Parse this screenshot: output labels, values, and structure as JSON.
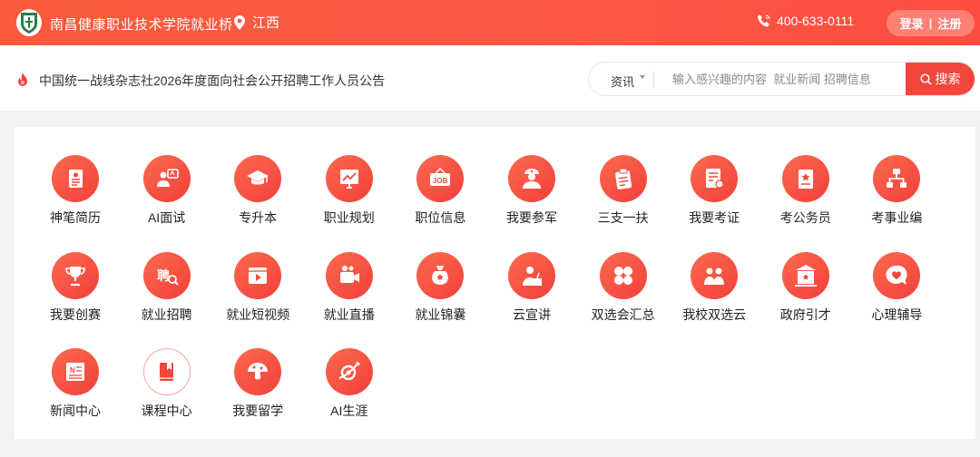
{
  "header": {
    "school_name": "南昌健康职业技术学院就业桥",
    "location": "江西",
    "phone": "400-633-0111",
    "login": "登录",
    "separator": "|",
    "register": "注册"
  },
  "newsbar": {
    "headline": "中国统一战线杂志社2026年度面向社会公开招聘工作人员公告",
    "search": {
      "category": "资讯",
      "placeholder": "输入感兴趣的内容  就业新闻 招聘信息",
      "button": "搜索"
    }
  },
  "services": [
    {
      "label": "神笔简历",
      "icon": "resume-icon"
    },
    {
      "label": "AI面试",
      "icon": "ai-interview-icon"
    },
    {
      "label": "专升本",
      "icon": "graduation-cap-icon"
    },
    {
      "label": "职业规划",
      "icon": "career-chart-icon"
    },
    {
      "label": "职位信息",
      "icon": "job-sign-icon"
    },
    {
      "label": "我要参军",
      "icon": "soldier-icon"
    },
    {
      "label": "三支一扶",
      "icon": "clipboard-icon"
    },
    {
      "label": "我要考证",
      "icon": "certificate-icon"
    },
    {
      "label": "考公务员",
      "icon": "star-document-icon"
    },
    {
      "label": "考事业编",
      "icon": "org-chart-icon"
    },
    {
      "label": "我要创赛",
      "icon": "trophy-icon"
    },
    {
      "label": "就业招聘",
      "icon": "recruit-search-icon"
    },
    {
      "label": "就业短视频",
      "icon": "video-play-icon"
    },
    {
      "label": "就业直播",
      "icon": "live-camera-icon"
    },
    {
      "label": "就业锦囊",
      "icon": "money-bag-icon"
    },
    {
      "label": "云宣讲",
      "icon": "speaker-podium-icon"
    },
    {
      "label": "双选会汇总",
      "icon": "grid-clover-icon"
    },
    {
      "label": "我校双选云",
      "icon": "two-people-icon"
    },
    {
      "label": "政府引才",
      "icon": "government-building-icon"
    },
    {
      "label": "心理辅导",
      "icon": "heart-chat-icon"
    },
    {
      "label": "新闻中心",
      "icon": "newspaper-icon"
    },
    {
      "label": "课程中心",
      "icon": "book-icon"
    },
    {
      "label": "我要留学",
      "icon": "mushroom-globe-icon"
    },
    {
      "label": "AI生涯",
      "icon": "planet-orbit-icon"
    }
  ],
  "colors": {
    "accent": "#f3473c",
    "header": "#fa5a3e"
  }
}
